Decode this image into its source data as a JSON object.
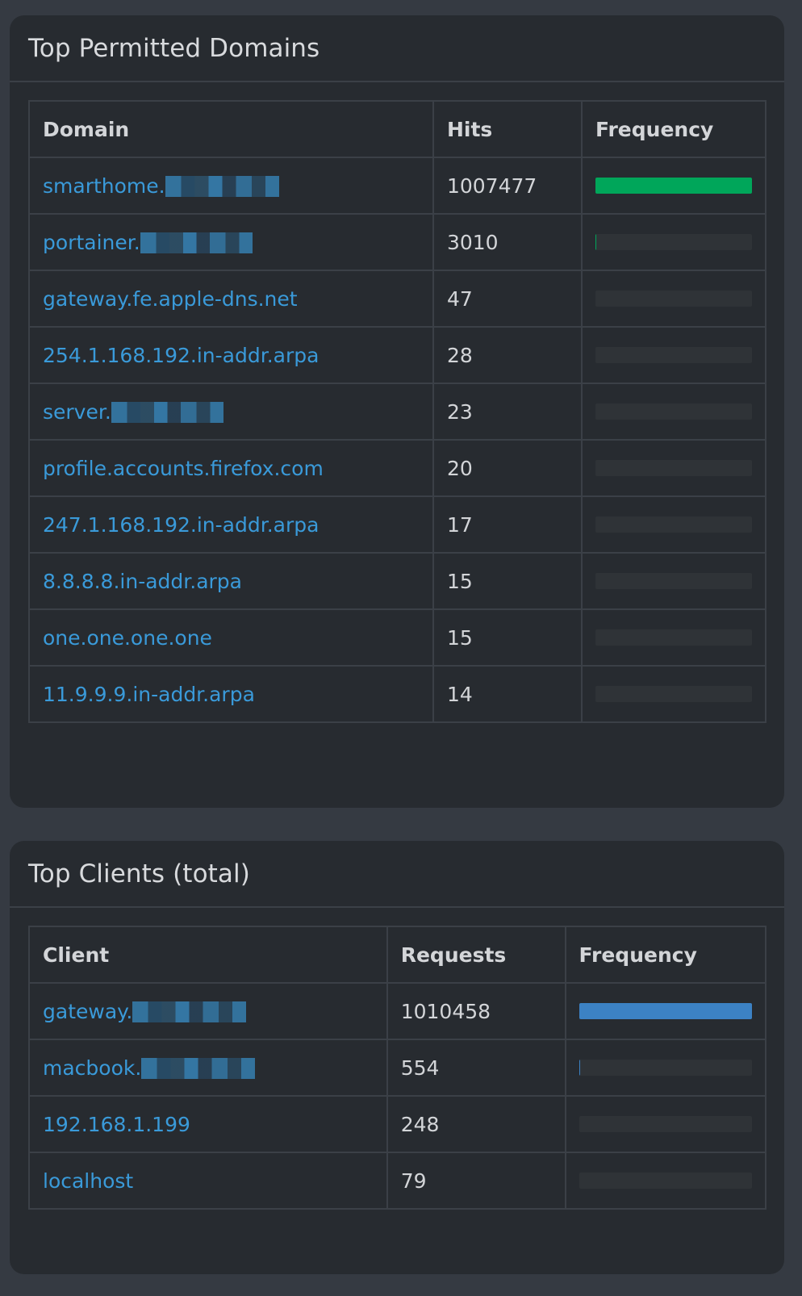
{
  "domains_panel": {
    "title": "Top Permitted Domains",
    "headers": {
      "name": "Domain",
      "count": "Hits",
      "freq": "Frequency"
    },
    "bar_color": "#00a65a",
    "rows": [
      {
        "name": "smarthome.",
        "redacted": true,
        "count": "1007477",
        "freq": 1.0
      },
      {
        "name": "portainer.",
        "redacted": true,
        "count": "3010",
        "freq": 0.003
      },
      {
        "name": "gateway.fe.apple-dns.net",
        "redacted": false,
        "count": "47",
        "freq": 0.0
      },
      {
        "name": "254.1.168.192.in-addr.arpa",
        "redacted": false,
        "count": "28",
        "freq": 0.0
      },
      {
        "name": "server.",
        "redacted": true,
        "count": "23",
        "freq": 0.0
      },
      {
        "name": "profile.accounts.firefox.com",
        "redacted": false,
        "count": "20",
        "freq": 0.0
      },
      {
        "name": "247.1.168.192.in-addr.arpa",
        "redacted": false,
        "count": "17",
        "freq": 0.0
      },
      {
        "name": "8.8.8.8.in-addr.arpa",
        "redacted": false,
        "count": "15",
        "freq": 0.0
      },
      {
        "name": "one.one.one.one",
        "redacted": false,
        "count": "15",
        "freq": 0.0
      },
      {
        "name": "11.9.9.9.in-addr.arpa",
        "redacted": false,
        "count": "14",
        "freq": 0.0
      }
    ]
  },
  "clients_panel": {
    "title": "Top Clients (total)",
    "headers": {
      "name": "Client",
      "count": "Requests",
      "freq": "Frequency"
    },
    "bar_color": "#3c82c4",
    "rows": [
      {
        "name": "gateway.",
        "redacted": true,
        "count": "1010458",
        "freq": 1.0
      },
      {
        "name": "macbook.",
        "redacted": true,
        "count": "554",
        "freq": 0.0005
      },
      {
        "name": "192.168.1.199",
        "redacted": false,
        "count": "248",
        "freq": 0.0
      },
      {
        "name": "localhost",
        "redacted": false,
        "count": "79",
        "freq": 0.0
      }
    ]
  }
}
